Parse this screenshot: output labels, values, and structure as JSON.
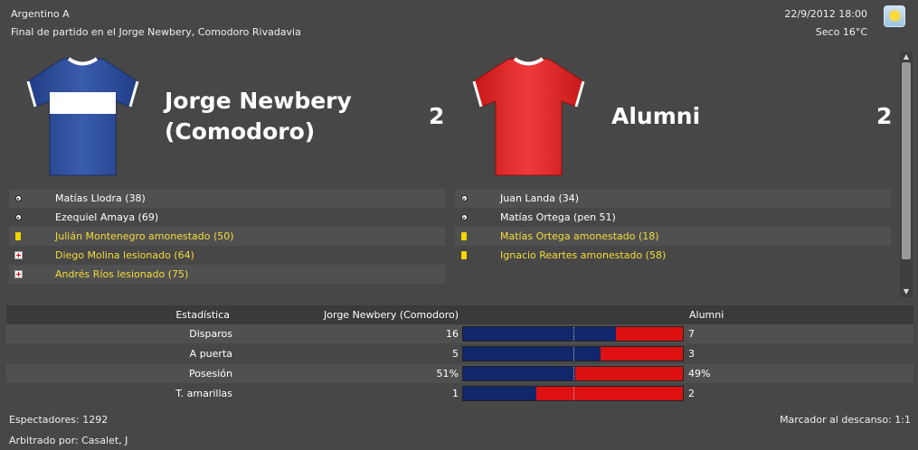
{
  "header": {
    "competition": "Argentino A",
    "venue_line": "Final de partido en el Jorge Newbery, Comodoro Rivadavia",
    "datetime": "22/9/2012 18:00",
    "weather_text": "Seco 16°C",
    "weather_icon": "sunny-icon"
  },
  "home": {
    "name_line1": "Jorge Newbery",
    "name_line2": "(Comodoro)",
    "score": "2",
    "shirt_body": "#2e4f9c",
    "shirt_band": "#ffffff",
    "events": [
      {
        "type": "goal",
        "text": "Matías Llodra (38)"
      },
      {
        "type": "goal",
        "text": "Ezequiel Amaya (69)"
      },
      {
        "type": "yellow",
        "text": "Julián Montenegro amonestado (50)"
      },
      {
        "type": "injury",
        "text": "Diego Molina lesionado (64)"
      },
      {
        "type": "injury",
        "text": "Andrés Ríos lesionado (75)"
      }
    ]
  },
  "away": {
    "name": "Alumni",
    "score": "2",
    "shirt_body": "#e22424",
    "events": [
      {
        "type": "goal",
        "text": "Juan Landa (34)"
      },
      {
        "type": "goal",
        "text": "Matías Ortega (pen 51)"
      },
      {
        "type": "yellow",
        "text": "Matías Ortega amonestado (18)"
      },
      {
        "type": "yellow",
        "text": "Ignacio Reartes amonestado (58)"
      }
    ]
  },
  "stats": {
    "header_label": "Estadística",
    "header_home": "Jorge Newbery (Comodoro)",
    "header_away": "Alumni",
    "home_color": "#12276b",
    "away_color": "#dd1111",
    "rows": [
      {
        "label": "Disparos",
        "home": "16",
        "away": "7",
        "home_share": 0.696
      },
      {
        "label": "A puerta",
        "home": "5",
        "away": "3",
        "home_share": 0.625
      },
      {
        "label": "Posesión",
        "home": "51%",
        "away": "49%",
        "home_share": 0.51
      },
      {
        "label": "T. amarillas",
        "home": "1",
        "away": "2",
        "home_share": 0.333
      }
    ]
  },
  "footer": {
    "attendance": "Espectadores: 1292",
    "referee": "Arbitrado por: Casalet, J",
    "halftime": "Marcador al descanso: 1:1"
  }
}
